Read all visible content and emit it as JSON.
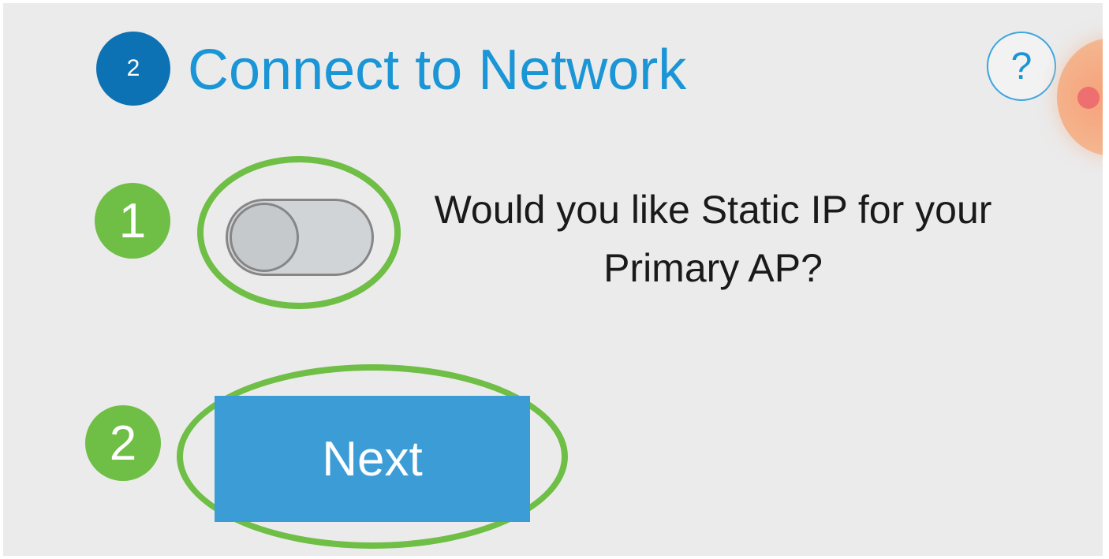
{
  "header": {
    "step_number": "2",
    "title": "Connect to Network",
    "help_icon": "?"
  },
  "static_ip": {
    "question": "Would you like Static IP for your Primary AP?",
    "toggle_on": false
  },
  "actions": {
    "next_label": "Next"
  },
  "callouts": {
    "toggle_number": "1",
    "next_number": "2"
  },
  "colors": {
    "accent_blue": "#1a95d6",
    "step_badge": "#0d72b3",
    "button_blue": "#3c9dd6",
    "callout_green": "#6fbe45",
    "background": "#ebebeb"
  }
}
